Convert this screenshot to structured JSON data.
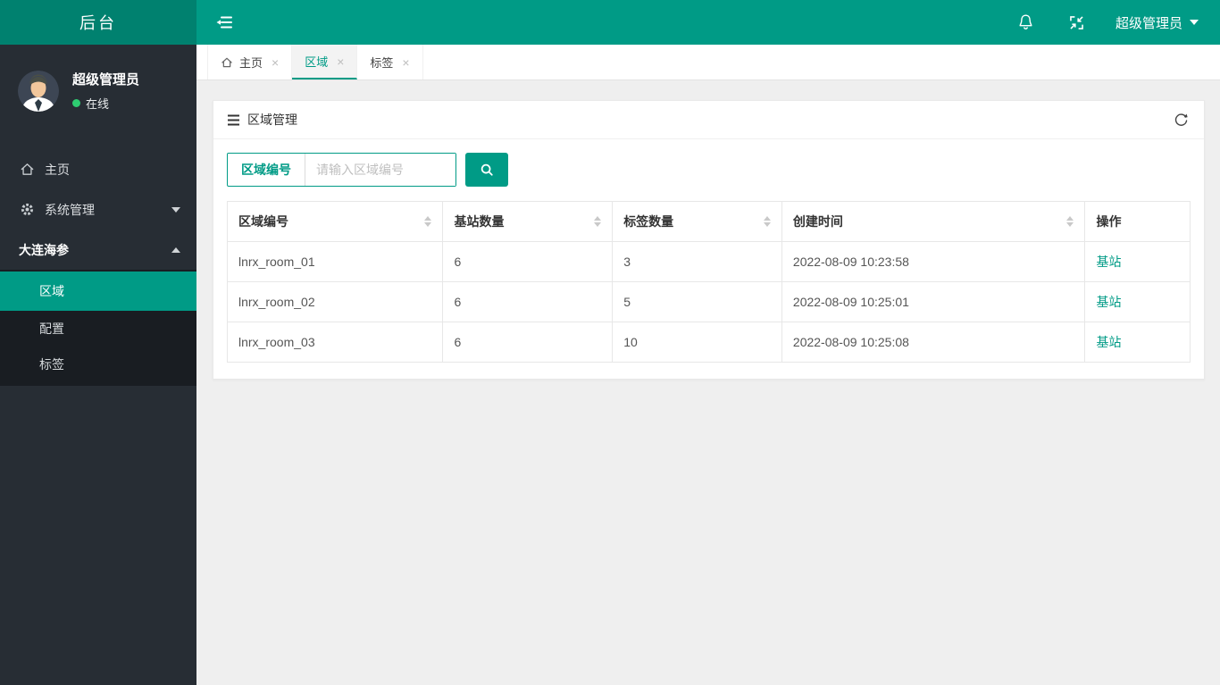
{
  "colors": {
    "accent": "#009b86",
    "logo_bg": "#00816f",
    "sidebar_bg": "#272d34",
    "submenu_bg": "#191d22",
    "status_green": "#2ecc71",
    "page_bg": "#efefef",
    "border": "#e7e7e7"
  },
  "icons": {
    "close": "×"
  },
  "sidebar": {
    "logo": "后台",
    "user": {
      "name": "超级管理员",
      "status": "在线"
    },
    "menu": {
      "home": "主页",
      "system": "系统管理",
      "group": "大连海参"
    },
    "submenu": [
      "区域",
      "配置",
      "标签"
    ]
  },
  "topbar": {
    "user": "超级管理员"
  },
  "tabs": [
    {
      "label": "主页"
    },
    {
      "label": "区域",
      "active": true
    },
    {
      "label": "标签"
    }
  ],
  "panel": {
    "title": "区域管理"
  },
  "search": {
    "label": "区域编号",
    "placeholder": "请输入区域编号"
  },
  "table": {
    "columns": [
      {
        "label": "区域编号",
        "sortable": true
      },
      {
        "label": "基站数量",
        "sortable": true
      },
      {
        "label": "标签数量",
        "sortable": true
      },
      {
        "label": "创建时间",
        "sortable": true
      },
      {
        "label": "操作",
        "sortable": false
      }
    ],
    "rows": [
      {
        "id": "lnrx_room_01",
        "stations": "6",
        "tags": "3",
        "created": "2022-08-09 10:23:58",
        "action": "基站"
      },
      {
        "id": "lnrx_room_02",
        "stations": "6",
        "tags": "5",
        "created": "2022-08-09 10:25:01",
        "action": "基站"
      },
      {
        "id": "lnrx_room_03",
        "stations": "6",
        "tags": "10",
        "created": "2022-08-09 10:25:08",
        "action": "基站"
      }
    ]
  }
}
